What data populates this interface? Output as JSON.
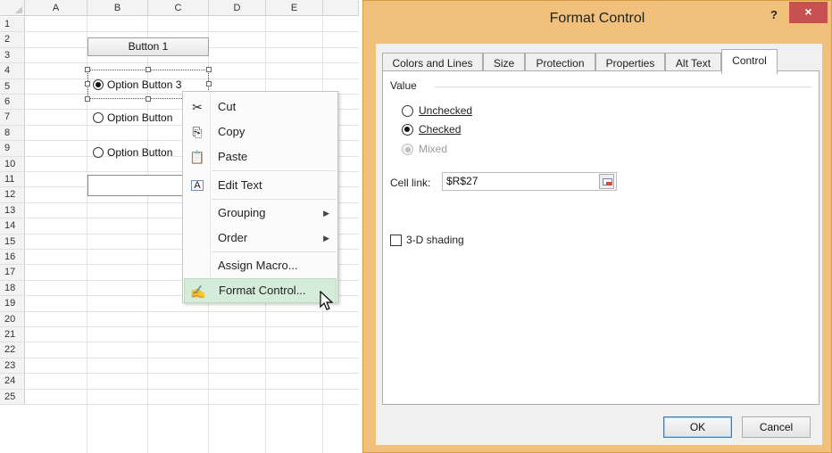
{
  "sheet": {
    "columns": [
      "A",
      "B",
      "C",
      "D",
      "E"
    ],
    "rows": [
      "1",
      "2",
      "3",
      "4",
      "5",
      "6",
      "7",
      "8",
      "9",
      "10",
      "11",
      "12",
      "13",
      "14",
      "15",
      "16",
      "17",
      "18",
      "19",
      "20",
      "21",
      "22",
      "23",
      "24",
      "25"
    ],
    "form_button_label": "Button 1",
    "option_buttons": [
      {
        "label": "Option Button 3",
        "checked": true
      },
      {
        "label": "Option Button",
        "checked": false
      },
      {
        "label": "Option Button",
        "checked": false
      }
    ]
  },
  "context_menu": {
    "items": [
      {
        "label": "Cut",
        "icon": "scissors-icon",
        "has_submenu": false
      },
      {
        "label": "Copy",
        "icon": "copy-icon",
        "has_submenu": false
      },
      {
        "label": "Paste",
        "icon": "paste-icon",
        "has_submenu": false
      },
      {
        "label": "Edit Text",
        "icon": "edit-text-icon",
        "has_submenu": false
      },
      {
        "label": "Grouping",
        "icon": "",
        "has_submenu": true
      },
      {
        "label": "Order",
        "icon": "",
        "has_submenu": true
      },
      {
        "label": "Assign Macro...",
        "icon": "",
        "has_submenu": false
      },
      {
        "label": "Format Control...",
        "icon": "format-control-icon",
        "has_submenu": false,
        "highlighted": true
      }
    ]
  },
  "dialog": {
    "title": "Format Control",
    "help": "?",
    "close": "×",
    "tabs": [
      "Colors and Lines",
      "Size",
      "Protection",
      "Properties",
      "Alt Text",
      "Control"
    ],
    "active_tab": "Control",
    "value_group_label": "Value",
    "value_options": [
      {
        "label": "Unchecked",
        "checked": false,
        "disabled": false
      },
      {
        "label": "Checked",
        "checked": true,
        "disabled": false
      },
      {
        "label": "Mixed",
        "checked": false,
        "disabled": true
      }
    ],
    "cell_link_label": "Cell link:",
    "cell_link_value": "$R$27",
    "shading_label": "3-D shading",
    "shading_checked": false,
    "ok_label": "OK",
    "cancel_label": "Cancel"
  },
  "colors": {
    "dialog_frame": "#f1c07a",
    "close_button": "#c75050",
    "menu_highlight": "#d5ecda"
  }
}
